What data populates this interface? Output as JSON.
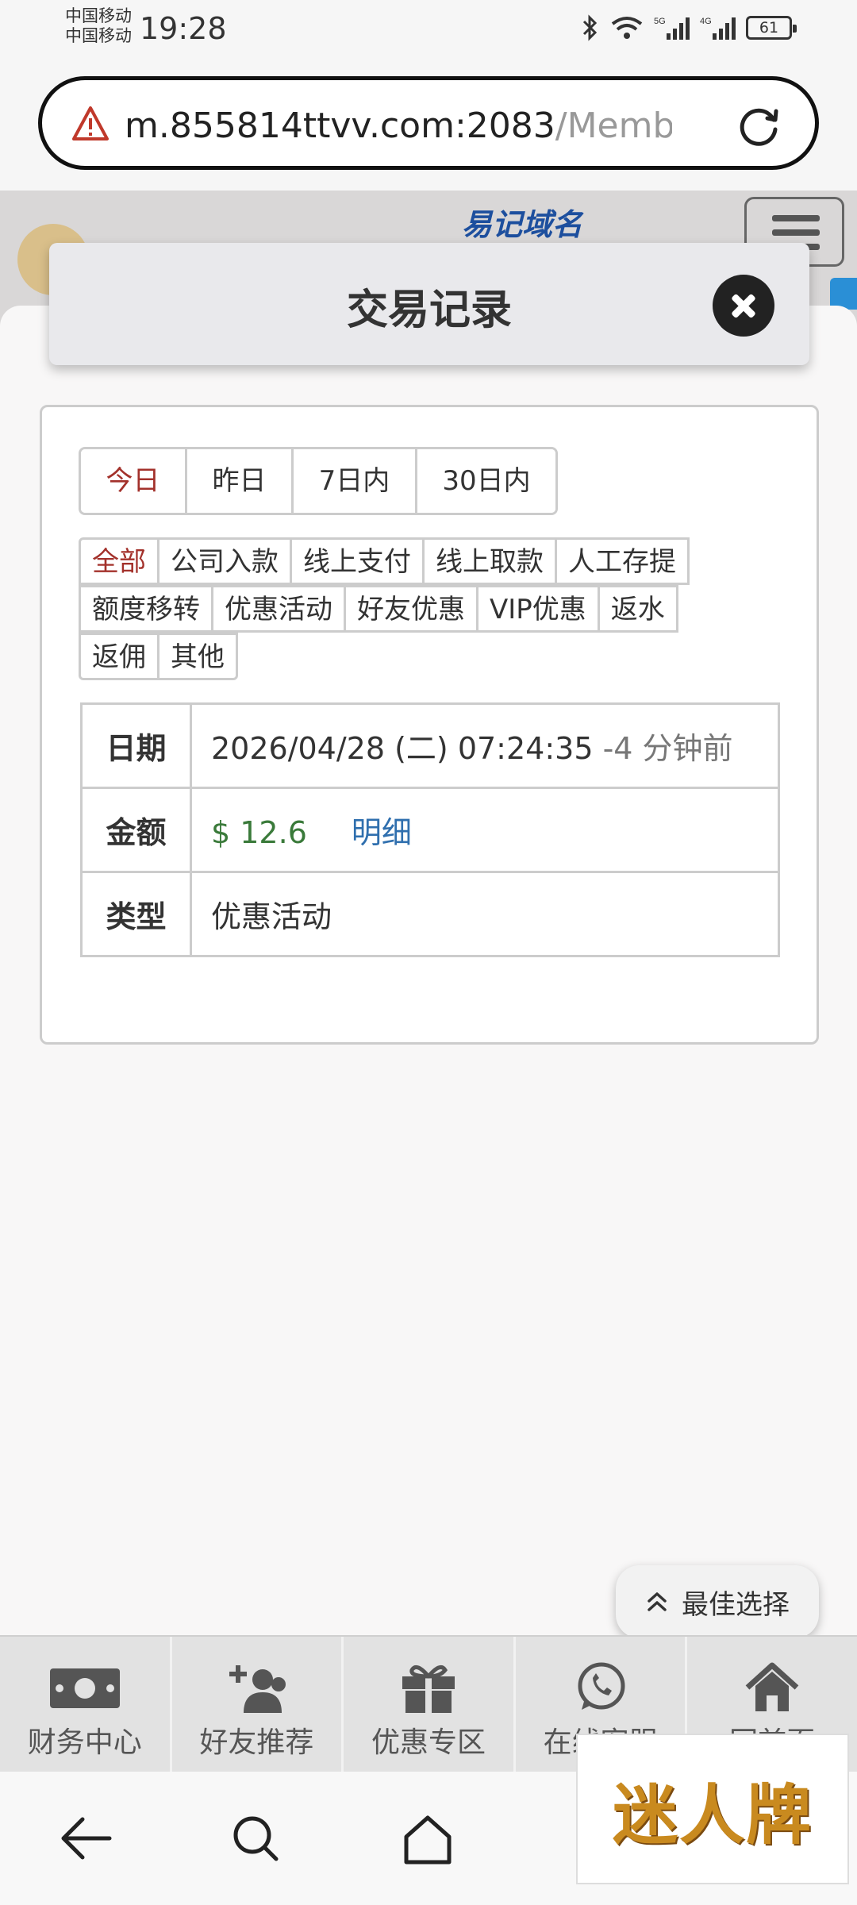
{
  "status_bar": {
    "carrier_line1": "中国移动",
    "carrier_line2": "中国移动",
    "time": "19:28",
    "battery": "61"
  },
  "browser": {
    "url_host": "m.855814ttvv.com:2083",
    "url_path": "/Member("
  },
  "site_header": {
    "tagline": "易记域名"
  },
  "modal": {
    "title": "交易记录"
  },
  "range_tabs": [
    {
      "label": "今日",
      "active": true
    },
    {
      "label": "昨日",
      "active": false
    },
    {
      "label": "7日内",
      "active": false
    },
    {
      "label": "30日内",
      "active": false
    }
  ],
  "type_filters": [
    [
      "全部",
      "公司入款",
      "线上支付",
      "线上取款",
      "人工存提"
    ],
    [
      "额度移转",
      "优惠活动",
      "好友优惠",
      "VIP优惠",
      "返水"
    ],
    [
      "返佣",
      "其他"
    ]
  ],
  "record": {
    "date_label": "日期",
    "date_value": "2026/04/28 (二) 07:24:35",
    "date_ago": "-4 分钟前",
    "amount_label": "金额",
    "amount_value": "$ 12.6",
    "detail_link": "明细",
    "type_label": "类型",
    "type_value": "优惠活动"
  },
  "best_choice": "最佳选择",
  "bottom_nav": [
    "财务中心",
    "好友推荐",
    "优惠专区",
    "在线客服",
    "回首页"
  ],
  "watermark": "迷人牌",
  "colors": {
    "active_red": "#a3312b",
    "amount_green": "#3a7a3a",
    "link_blue": "#2f6fae"
  }
}
